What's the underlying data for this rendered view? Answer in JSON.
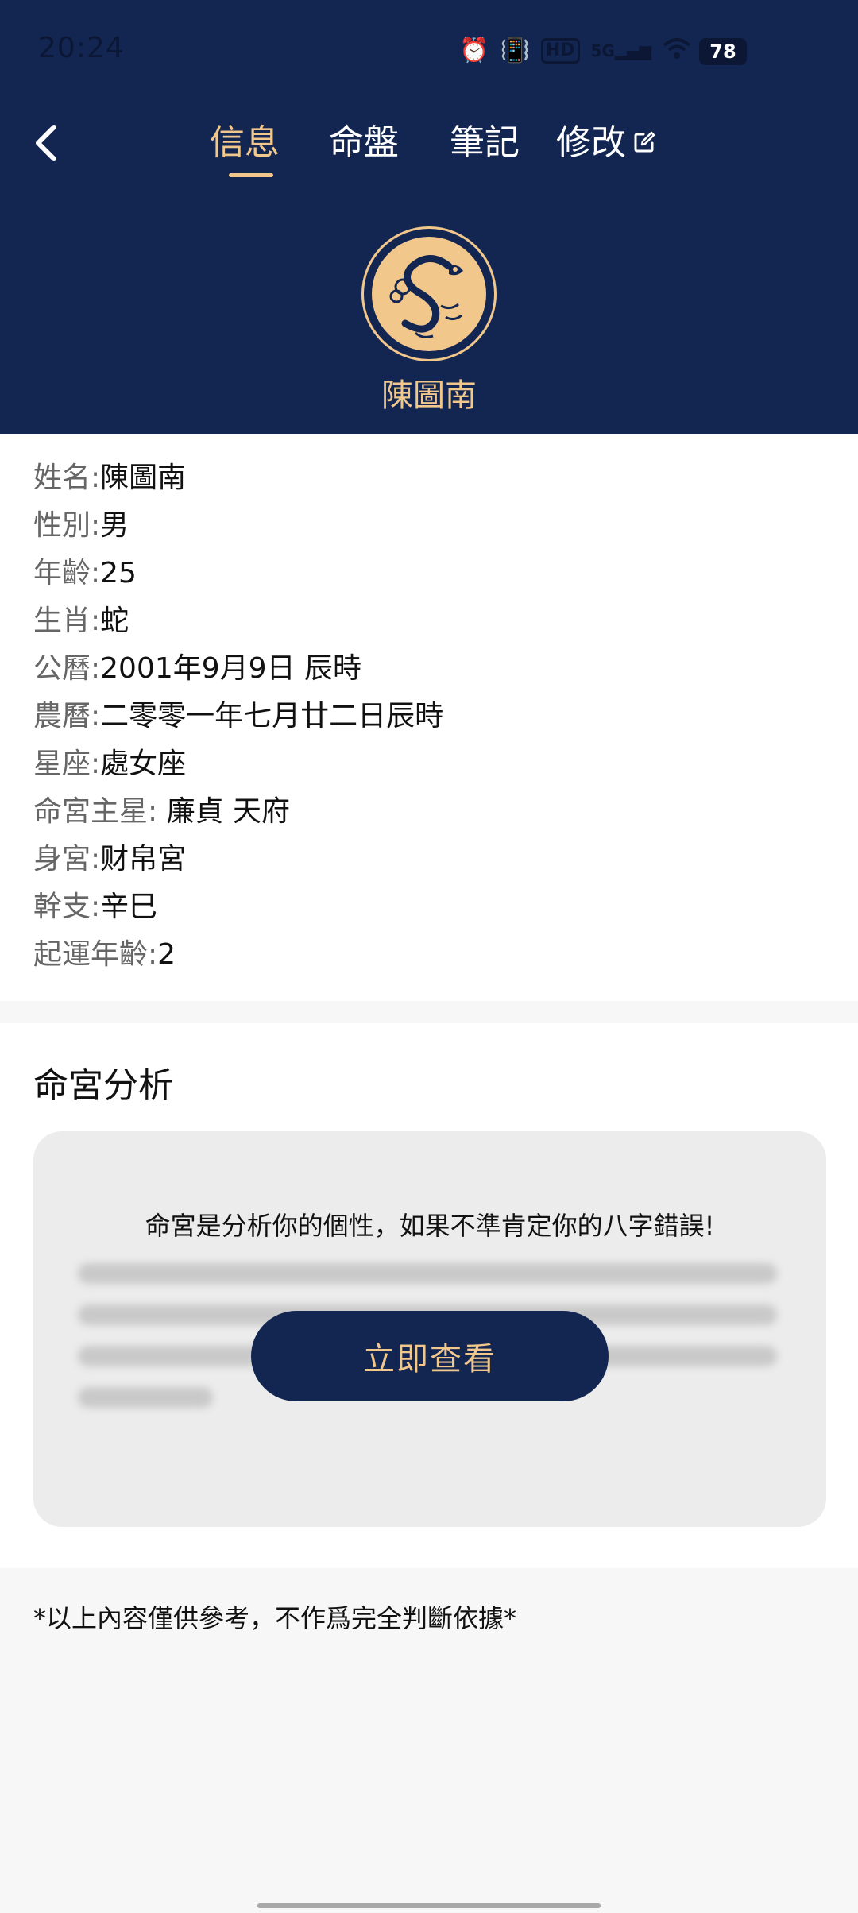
{
  "status_bar": {
    "time": "20:24",
    "signal_label": "5G",
    "battery": "78"
  },
  "nav": {
    "tabs": [
      {
        "label": "信息",
        "active": true
      },
      {
        "label": "命盤",
        "active": false
      },
      {
        "label": "筆記",
        "active": false
      },
      {
        "label": "修改",
        "active": false
      }
    ]
  },
  "profile": {
    "name": "陳圖南",
    "zodiac_icon": "snake-icon"
  },
  "info": [
    {
      "label": "姓名:",
      "value": "陳圖南"
    },
    {
      "label": "性別:",
      "value": "男"
    },
    {
      "label": "年齡:",
      "value": "25"
    },
    {
      "label": "生肖:",
      "value": "蛇"
    },
    {
      "label": "公曆:",
      "value": "2001年9月9日 辰時"
    },
    {
      "label": "農曆:",
      "value": "二零零一年七月廿二日辰時"
    },
    {
      "label": "星座:",
      "value": "處女座"
    },
    {
      "label": "命宮主星:",
      "value": " 廉貞 天府"
    },
    {
      "label": "身宮:",
      "value": "财帛宮"
    },
    {
      "label": "幹支:",
      "value": "辛巳"
    },
    {
      "label": "起運年齡:",
      "value": "2"
    }
  ],
  "analysis": {
    "title": "命宮分析",
    "intro": "命宮是分析你的個性，如果不準肯定你的八字錯誤!",
    "button_label": "立即查看"
  },
  "disclaimer": "*以上內容僅供參考，不作爲完全判斷依據*",
  "colors": {
    "header_bg": "#132652",
    "accent_gold": "#f2c78c",
    "page_bg": "#f7f7f7"
  }
}
